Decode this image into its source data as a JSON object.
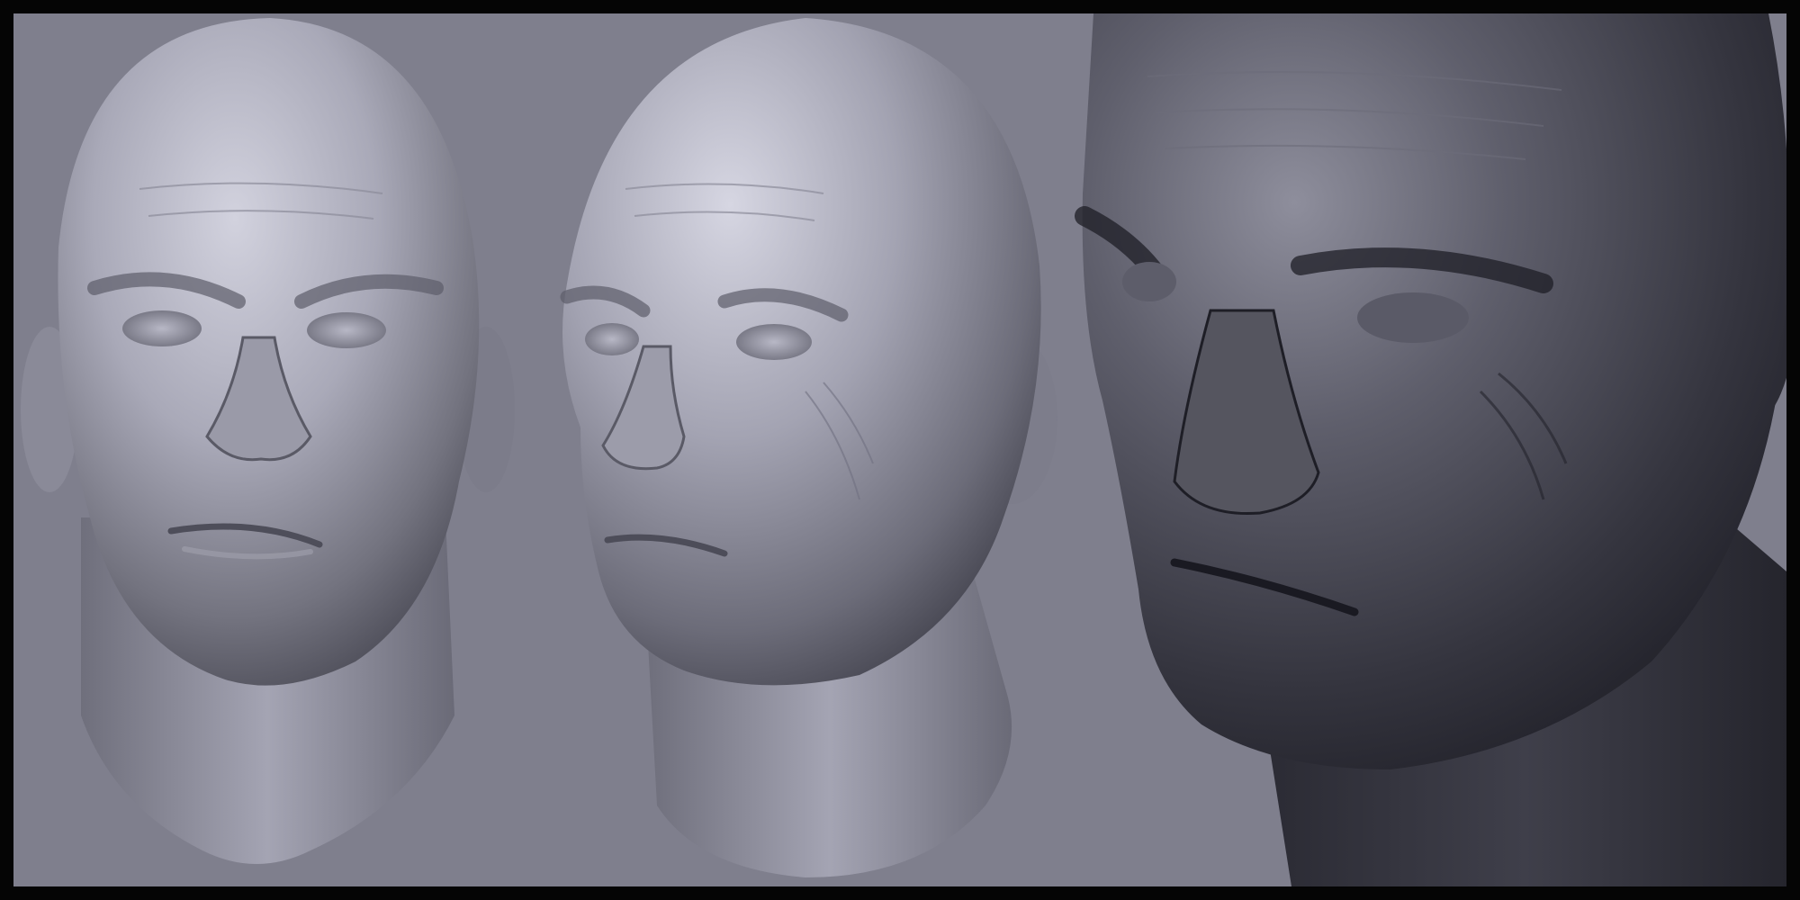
{
  "scene": {
    "colors": {
      "frame": "#050505",
      "background": "#7f7f8d",
      "skin_light": "#c9c9d6",
      "skin_mid": "#8f8f9e",
      "skin_dark": "#3e3e4a"
    },
    "views": [
      {
        "name": "front-view"
      },
      {
        "name": "three-quarter-view"
      },
      {
        "name": "close-up-view"
      }
    ]
  }
}
